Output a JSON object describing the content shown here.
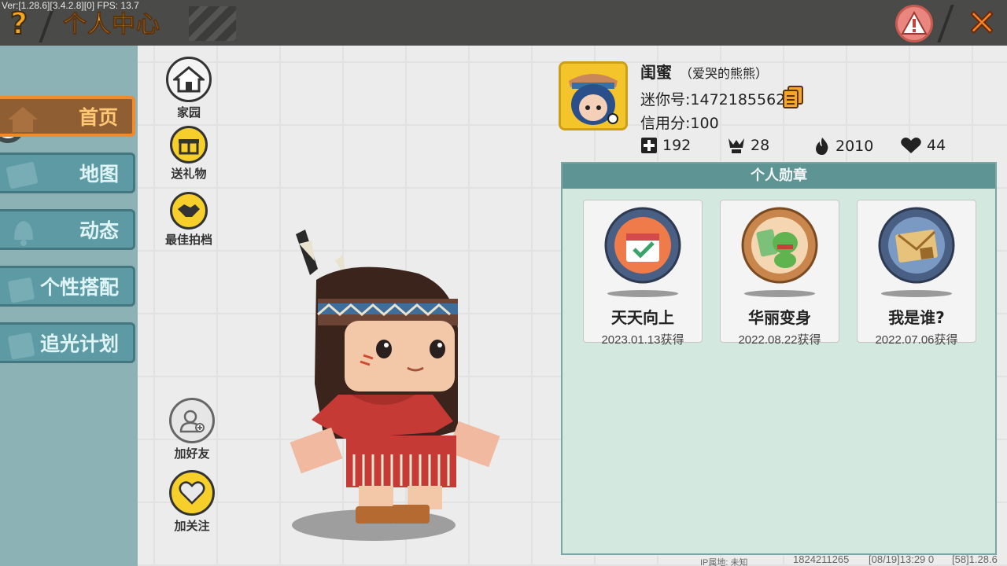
{
  "header": {
    "version": "Ver:[1.28.6][3.4.2.8][0] FPS: 13.7",
    "help_glyph": "?",
    "title": "个人中心",
    "close_glyph": "✕"
  },
  "sidebar": {
    "items": [
      {
        "label": "首页",
        "icon": "home-icon",
        "active": true
      },
      {
        "label": "地图",
        "icon": "map-icon",
        "active": false
      },
      {
        "label": "动态",
        "icon": "bell-icon",
        "active": false
      },
      {
        "label": "个性搭配",
        "icon": "outfit-icon",
        "active": false
      },
      {
        "label": "追光计划",
        "icon": "plan-icon",
        "active": false
      }
    ]
  },
  "actions": {
    "home": "家园",
    "gift": "送礼物",
    "partner": "最佳拍档",
    "add_friend": "加好友",
    "follow": "加关注"
  },
  "profile": {
    "name": "闺蜜",
    "subtitle": "（爱哭的熊熊）",
    "mini_id": "迷你号:1472185562",
    "credit": "信用分:100",
    "stats": [
      {
        "icon": "plus-square-icon",
        "value": "192"
      },
      {
        "icon": "trophy-icon",
        "value": "28"
      },
      {
        "icon": "flame-icon",
        "value": "2010"
      },
      {
        "icon": "heart-icon",
        "value": "44"
      }
    ]
  },
  "medals": {
    "title": "个人勋章",
    "items": [
      {
        "name": "天天向上",
        "date": "2023.01.13获得"
      },
      {
        "name": "华丽变身",
        "date": "2022.08.22获得"
      },
      {
        "name": "我是谁?",
        "date": "2022.07.06获得"
      }
    ]
  },
  "footer": {
    "ip": "IP属地: 未知",
    "uid": "1824211265",
    "time": "[08/19]13:29 0",
    "build": "[58]1.28.6"
  },
  "colors": {
    "accent_orange": "#f08a2a",
    "sidebar_bg": "#8cb2b6",
    "nav_item": "#5d9aa3",
    "panel_header": "#5f9495",
    "panel_bg": "#d3e9df",
    "action_yellow": "#f6cf2a"
  }
}
